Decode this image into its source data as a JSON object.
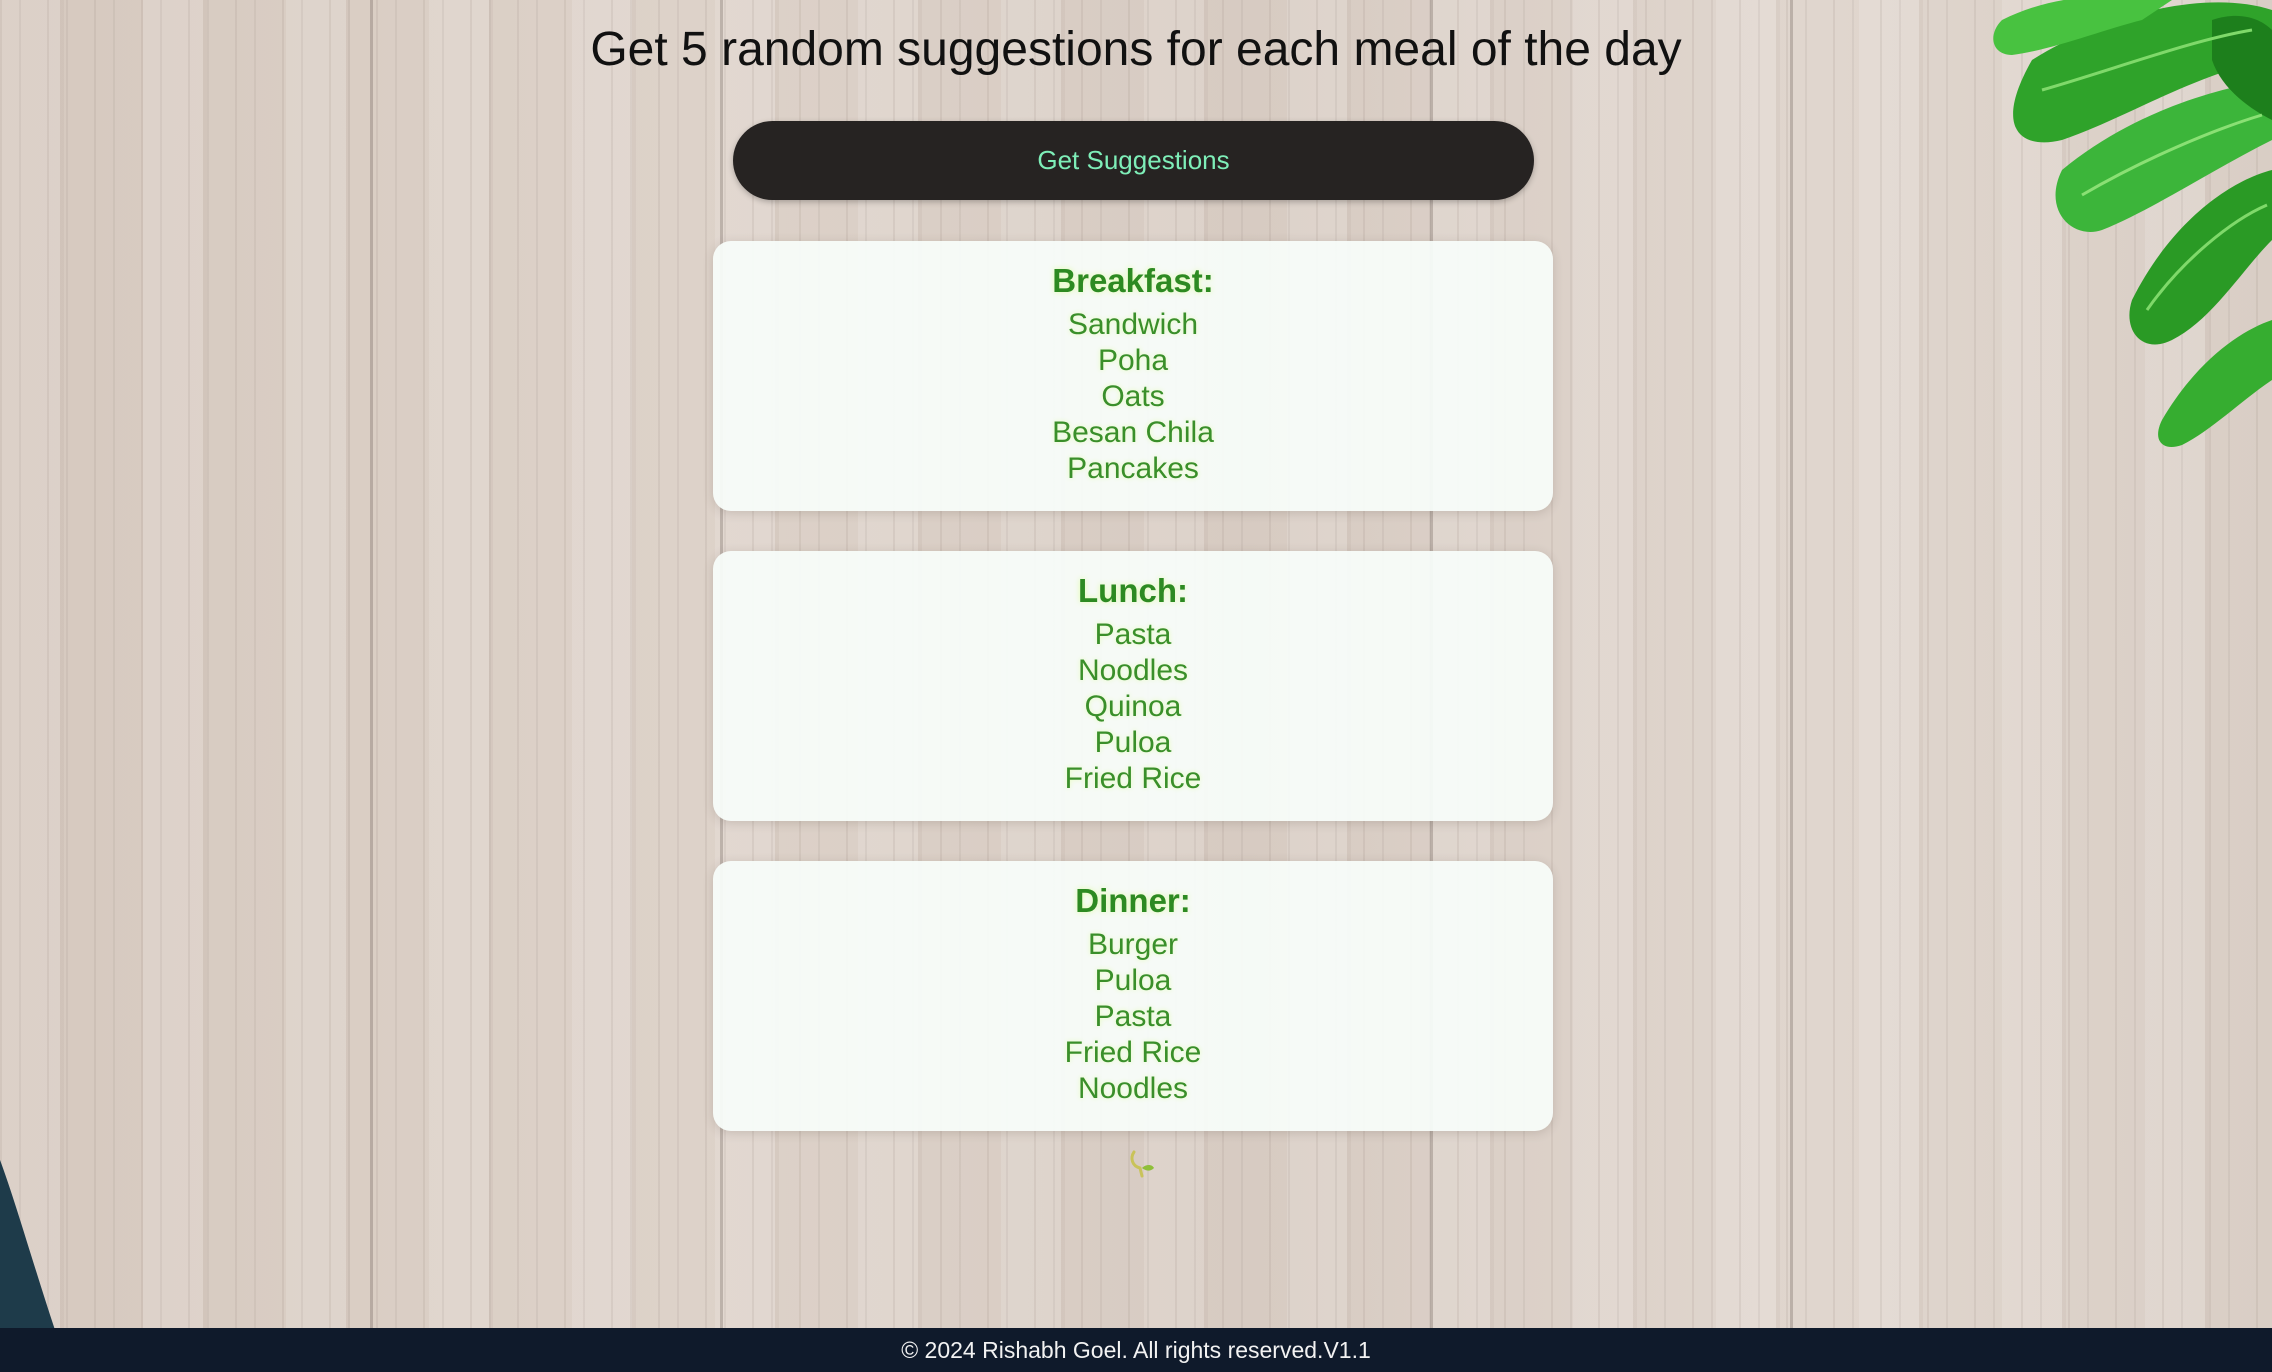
{
  "header": {
    "title": "Get 5 random suggestions for each meal of the day"
  },
  "actions": {
    "suggest_label": "Get Suggestions"
  },
  "meals": [
    {
      "title": "Breakfast:",
      "items": [
        "Sandwich",
        "Poha",
        "Oats",
        "Besan Chila",
        "Pancakes"
      ]
    },
    {
      "title": "Lunch:",
      "items": [
        "Pasta",
        "Noodles",
        "Quinoa",
        "Puloa",
        "Fried Rice"
      ]
    },
    {
      "title": "Dinner:",
      "items": [
        "Burger",
        "Puloa",
        "Pasta",
        "Fried Rice",
        "Noodles"
      ]
    }
  ],
  "footer": {
    "text": "© 2024 Rishabh Goel. All rights reserved.V1.1"
  },
  "icons": {
    "sprout": "sprout-icon",
    "leaves": "leaves-decoration"
  },
  "colors": {
    "accent_green": "#2d8a22",
    "button_bg": "#262322",
    "button_text": "#7eeeb8",
    "footer_bg": "#0f1a2b"
  }
}
